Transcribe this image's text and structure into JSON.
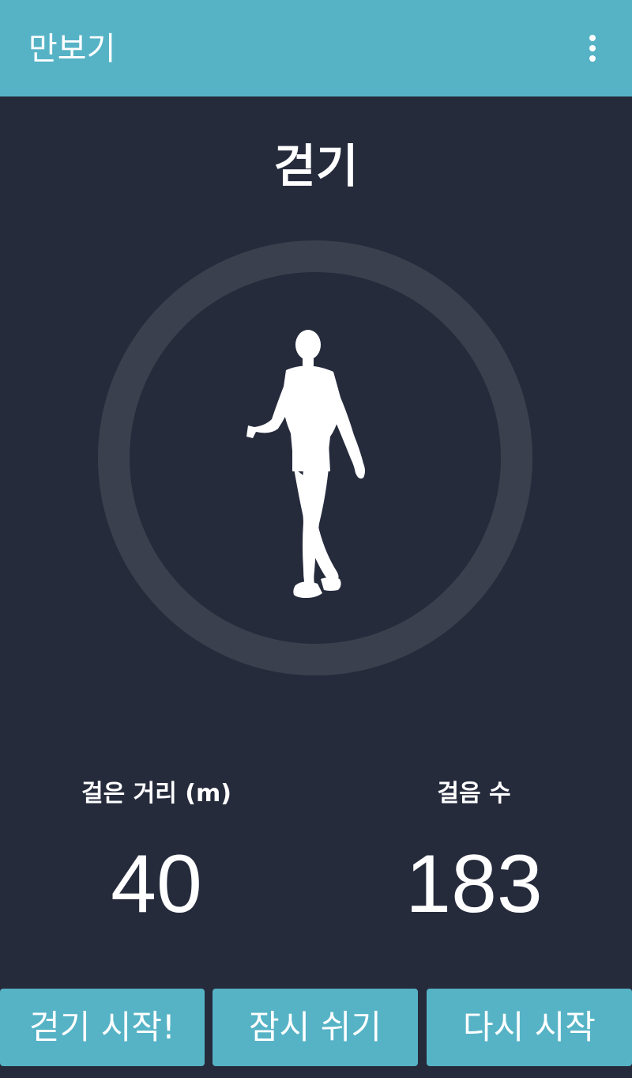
{
  "appbar": {
    "title": "만보기",
    "menu_icon": "more-vert-icon"
  },
  "mode": {
    "title": "걷기",
    "figure_icon": "walking-person-icon"
  },
  "stats": {
    "distance": {
      "label": "걸은 거리 (m)",
      "value": "40"
    },
    "steps": {
      "label": "걸음 수",
      "value": "183"
    }
  },
  "buttons": {
    "start": "걷기 시작!",
    "pause": "잠시 쉬기",
    "restart": "다시 시작"
  },
  "colors": {
    "primary": "#56b3c6",
    "background": "#262b3c",
    "ring": "#3b404e",
    "text": "#ffffff"
  }
}
